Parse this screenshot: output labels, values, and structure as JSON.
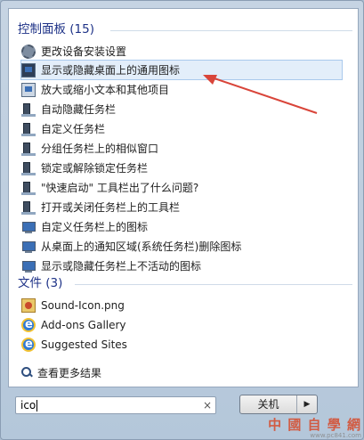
{
  "control_panel": {
    "header": "控制面板 (15)",
    "items": [
      {
        "label": "更改设备安装设置",
        "icon": "device-settings-icon",
        "selected": false
      },
      {
        "label": "显示或隐藏桌面上的通用图标",
        "icon": "desktop-icon",
        "selected": true
      },
      {
        "label": "放大或缩小文本和其他项目",
        "icon": "display-icon",
        "selected": false
      },
      {
        "label": "自动隐藏任务栏",
        "icon": "taskbar-icon",
        "selected": false
      },
      {
        "label": "自定义任务栏",
        "icon": "taskbar-icon",
        "selected": false
      },
      {
        "label": "分组任务栏上的相似窗口",
        "icon": "taskbar-icon",
        "selected": false
      },
      {
        "label": "锁定或解除锁定任务栏",
        "icon": "taskbar-icon",
        "selected": false
      },
      {
        "label": "\"快速启动\" 工具栏出了什么问题?",
        "icon": "taskbar-icon",
        "selected": false
      },
      {
        "label": "打开或关闭任务栏上的工具栏",
        "icon": "taskbar-icon",
        "selected": false
      },
      {
        "label": "自定义任务栏上的图标",
        "icon": "notification-area-icon",
        "selected": false
      },
      {
        "label": "从桌面上的通知区域(系统任务栏)删除图标",
        "icon": "notification-area-icon",
        "selected": false
      },
      {
        "label": "显示或隐藏任务栏上不活动的图标",
        "icon": "notification-area-icon",
        "selected": false
      }
    ]
  },
  "files": {
    "header": "文件 (3)",
    "items": [
      {
        "label": "Sound-Icon.png",
        "icon": "image-file-icon"
      },
      {
        "label": "Add-ons Gallery",
        "icon": "ie-icon"
      },
      {
        "label": "Suggested Sites",
        "icon": "ie-icon"
      }
    ]
  },
  "see_more": "查看更多结果",
  "search": {
    "value": "ico",
    "clear": "×"
  },
  "shutdown": {
    "label": "关机",
    "arrow": "▶"
  },
  "watermark": {
    "cn": "中 國 自 學 網",
    "en": "www.pc841.com"
  },
  "colors": {
    "header": "#1e3287",
    "annotation_arrow": "#d9453a",
    "selection": "#e3eefa"
  }
}
